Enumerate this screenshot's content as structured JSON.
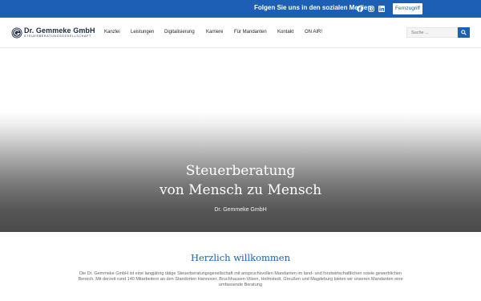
{
  "topbar": {
    "social_text": "Folgen Sie uns in den sozialen Medien",
    "social_icons": [
      "facebook-icon",
      "instagram-icon",
      "linkedin-icon"
    ],
    "fernzugriff_label": "Fernzugriff",
    "background_color": "#1d5fb4"
  },
  "header": {
    "logo": {
      "name": "Dr. Gemmeke GmbH",
      "sub": "STEUERBERATUNGSGESELLSCHAFT"
    },
    "nav": [
      "Kanzlei",
      "Leistungen",
      "Digitalisierung",
      "Karriere",
      "Für Mandanten",
      "Kontakt",
      "ON AIR!"
    ],
    "search_placeholder": "Suche ...",
    "accent_color": "#1d5fb4"
  },
  "hero": {
    "title_line1": "Steuerberatung",
    "title_line2": "von Mensch zu Mensch",
    "subtitle": "Dr. Gemmeke GmbH"
  },
  "welcome": {
    "title": "Herzlich willkommen",
    "text": "Die Dr. Gemmeke GmbH ist eine langjährig tätige Steuerberatungsgesellschaft mit anspruchsvollen Mandanten im land- und forstwirtschaftlichen sowie gewerblichen Bereich. Mit derzeit rund 140 Mitarbeitern an den Standorten Hannover, Bruchhausen-Vilsen, Helmstedt, Greußen und Magdeburg bieten wir unseren Mandanten eine umfassende Beratung"
  }
}
